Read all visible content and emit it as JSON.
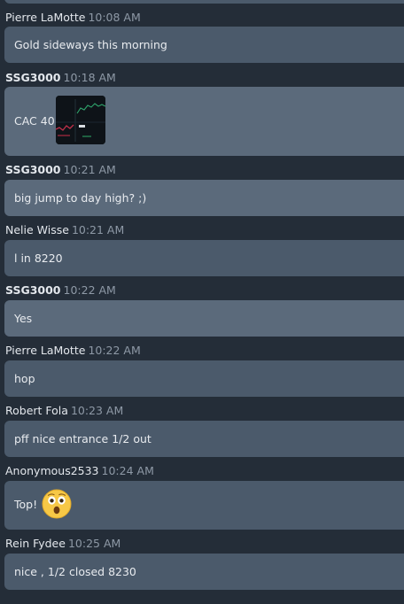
{
  "messages": [
    {
      "author": "Pierre LaMotte",
      "time": "10:08 AM",
      "text": "Gold sideways this morning"
    },
    {
      "author": "SSG3000",
      "time": "10:18 AM",
      "text": "CAC 40"
    },
    {
      "author": "SSG3000",
      "time": "10:21 AM",
      "text": "big jump to day high? ;)"
    },
    {
      "author": "Nelie Wisse",
      "time": "10:21 AM",
      "text": "l in 8220"
    },
    {
      "author": "SSG3000",
      "time": "10:22 AM",
      "text": "Yes"
    },
    {
      "author": "Pierre LaMotte",
      "time": "10:22 AM",
      "text": "hop"
    },
    {
      "author": "Robert Fola",
      "time": "10:23 AM",
      "text": "pff nice entrance 1/2 out"
    },
    {
      "author": "Anonymous2533",
      "time": "10:24 AM",
      "text": "Top!"
    },
    {
      "author": "Rein Fydee",
      "time": "10:25 AM",
      "text": "nice , 1/2 closed 8230"
    }
  ],
  "icons": {
    "chart_thumbnail": "chart-thumbnail-image",
    "emoji": "astonished-face-emoji"
  },
  "colors": {
    "background": "#242d38",
    "bubble": "#4b5a6b",
    "bubble_highlight": "#5b6a7b",
    "author": "#e3e7ec",
    "timestamp": "#8e99a6",
    "message_text": "#e8ebef",
    "emoji_yellow": "#f7c846"
  }
}
